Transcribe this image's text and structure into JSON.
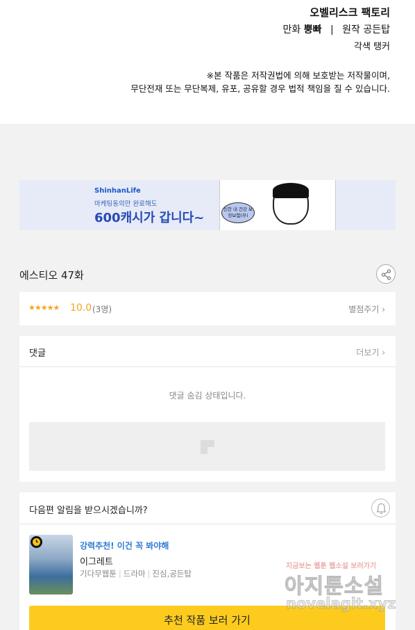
{
  "credits": {
    "studio": "오벨리스크 팩토리",
    "comic_role": "만화",
    "comic_name": "뿡빠",
    "separator": "|",
    "original_role": "원작",
    "original_name": "공든탑",
    "color_credit": "각색 탱커",
    "notice_line1": "※본 작품은 저작권법에 의해 보호받는 저작물이며,",
    "notice_line2": "무단전재 또는 무단복제, 유포, 공유할 경우 법적 책임을 질 수 있습니다."
  },
  "banner": {
    "brand": "ShinhanLife",
    "sub": "마케팅동의만 완료해도",
    "headline": "600캐시가 갑니다~",
    "bubble": "신한 내 건강 보장보험(무)"
  },
  "episode": {
    "title": "에스티오 47화"
  },
  "rating": {
    "stars": "★★★★★",
    "score": "10.0",
    "count": "(3명)",
    "rate_link": "별점주기"
  },
  "comments": {
    "label": "댓글",
    "more": "더보기",
    "hidden_message": "댓글 숨김 상태입니다."
  },
  "alert": {
    "question": "다음편 알림을 받으시겠습니까?"
  },
  "recommendation": {
    "badge": "강력추천! 이건 꼭 봐야해",
    "title": "이그레트",
    "genre": "기다무웹툰",
    "category": "드라마",
    "authors": "진심,공든탑",
    "cta": "추천 작품 보러 가기"
  },
  "watermark": {
    "top": "지금보는 웹툰 웹소설 보러가기",
    "main": "아지툰소설",
    "url": "novelagit.xyz"
  },
  "colors": {
    "accent_yellow": "#fccb1d",
    "star_orange": "#f4a51c",
    "link_blue": "#2f7bd6",
    "page_gray": "#f2f2f2"
  }
}
